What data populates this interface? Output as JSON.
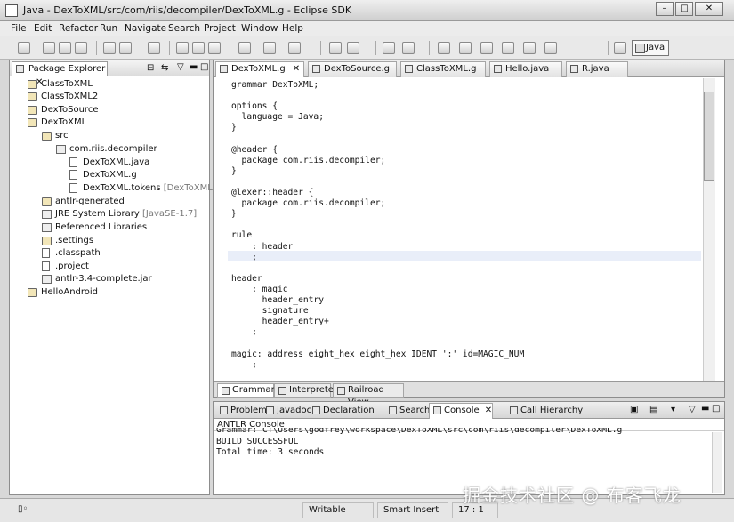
{
  "window": {
    "title": "Java - DexToXML/src/com/riis/decompiler/DexToXML.g - Eclipse SDK",
    "minimize": "–",
    "maximize": "□",
    "close": "✕"
  },
  "menu": [
    "File",
    "Edit",
    "Refactor",
    "Run",
    "Navigate",
    "Search",
    "Project",
    "Window",
    "Help"
  ],
  "toolbar": {
    "perspective": "Java"
  },
  "package_explorer": {
    "title": "Package Explorer",
    "tree": [
      {
        "label": "ClassToXML",
        "extra": ""
      },
      {
        "label": "ClassToXML2",
        "extra": ""
      },
      {
        "label": "DexToSource",
        "extra": ""
      },
      {
        "label": "DexToXML",
        "extra": ""
      },
      {
        "label": "src",
        "extra": ""
      },
      {
        "label": "com.riis.decompiler",
        "extra": ""
      },
      {
        "label": "DexToXML.java",
        "extra": ""
      },
      {
        "label": "DexToXML.g",
        "extra": ""
      },
      {
        "label": "DexToXML.tokens",
        "extra": "[DexToXML.g]"
      },
      {
        "label": "antlr-generated",
        "extra": ""
      },
      {
        "label": "JRE System Library",
        "extra": "[JavaSE-1.7]"
      },
      {
        "label": "Referenced Libraries",
        "extra": ""
      },
      {
        "label": ".settings",
        "extra": ""
      },
      {
        "label": ".classpath",
        "extra": ""
      },
      {
        "label": ".project",
        "extra": ""
      },
      {
        "label": "antlr-3.4-complete.jar",
        "extra": ""
      },
      {
        "label": "HelloAndroid",
        "extra": ""
      }
    ]
  },
  "editor": {
    "tabs": [
      "DexToXML.g",
      "DexToSource.g",
      "ClassToXML.g",
      "Hello.java",
      "R.java"
    ],
    "code_lines": [
      "grammar DexToXML;",
      "",
      "options {",
      "  language = Java;",
      "}",
      "",
      "@header {",
      "  package com.riis.decompiler;",
      "}",
      "",
      "@lexer::header {",
      "  package com.riis.decompiler;",
      "}",
      "",
      "rule",
      "    : header",
      "    ;",
      "",
      "header",
      "    : magic",
      "      header_entry",
      "      signature",
      "      header_entry+",
      "    ;",
      "",
      "magic: address eight_hex eight_hex IDENT ':' id=MAGIC_NUM",
      "    ;"
    ],
    "bottom_tabs": [
      "Grammar",
      "Interpreter",
      "Railroad View"
    ]
  },
  "console": {
    "tabs": [
      "Problems",
      "Javadoc",
      "Declaration",
      "Search",
      "Console",
      "Call Hierarchy"
    ],
    "header": "ANTLR Console",
    "lines": [
      "Grammar: C:\\Users\\godfrey\\workspace\\DexToXML\\src\\com\\riis\\decompiler\\DexToXML.g",
      "BUILD SUCCESSFUL",
      "Total time: 3 seconds"
    ]
  },
  "status": {
    "writable": "Writable",
    "insert_mode": "Smart Insert",
    "position": "17 : 1"
  },
  "watermark": "掘金技术社区 @ 布客飞龙"
}
